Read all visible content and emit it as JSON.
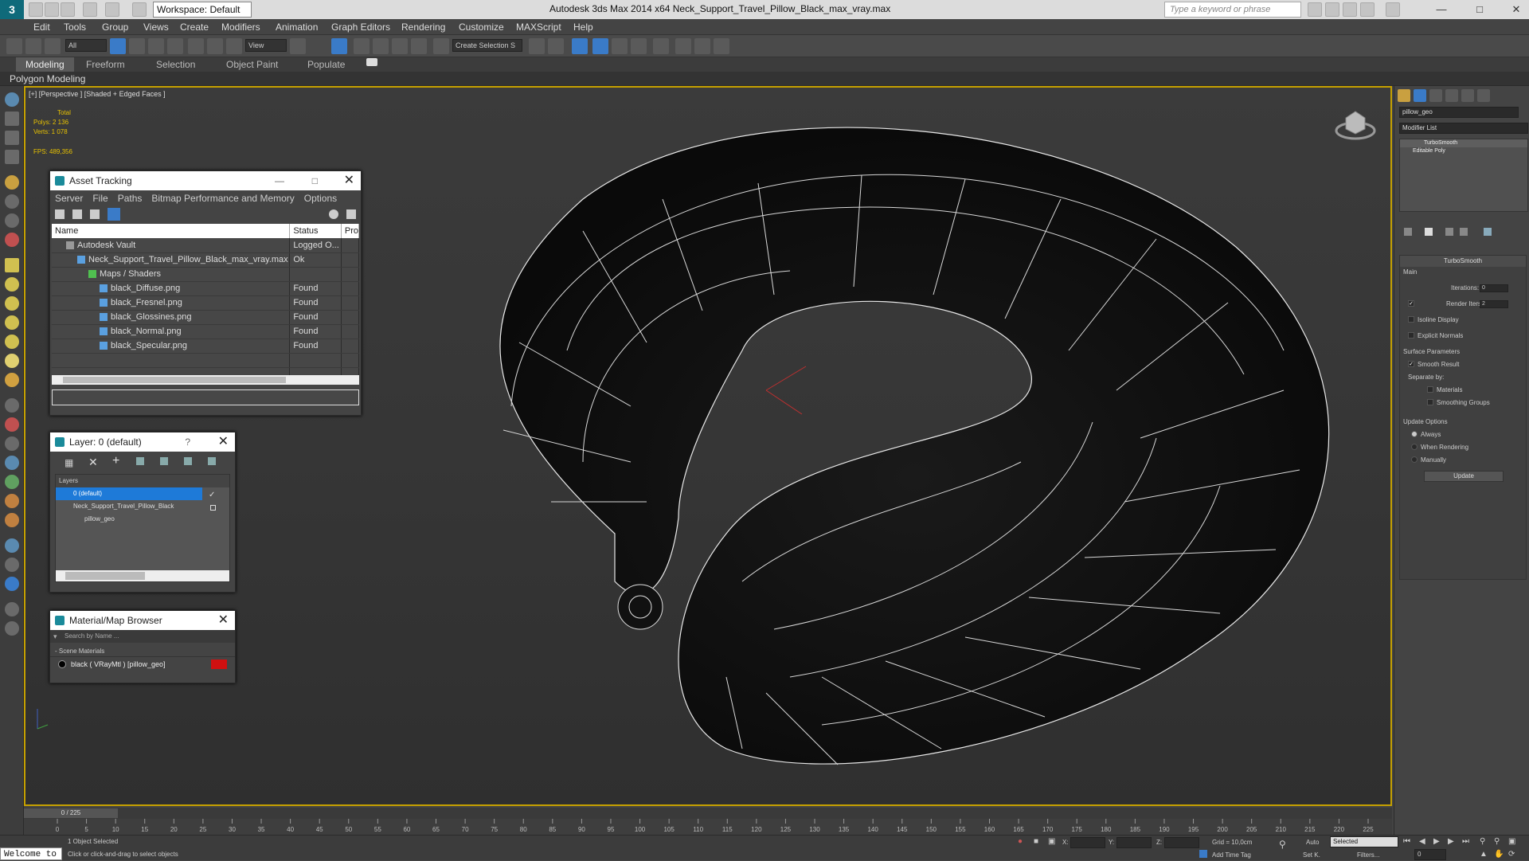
{
  "app": {
    "logo": "3",
    "workspace": "Workspace: Default",
    "title": "Autodesk 3ds Max  2014 x64     Neck_Support_Travel_Pillow_Black_max_vray.max",
    "search_placeholder": "Type a keyword or phrase"
  },
  "menu": [
    "Edit",
    "Tools",
    "Group",
    "Views",
    "Create",
    "Modifiers",
    "Animation",
    "Graph Editors",
    "Rendering",
    "Customize",
    "MAXScript",
    "Help"
  ],
  "toolbar": {
    "filter": "All",
    "refcoord": "View",
    "selection_set": "Create Selection S"
  },
  "ribbon": {
    "tabs": [
      "Modeling",
      "Freeform",
      "Selection",
      "Object Paint",
      "Populate"
    ],
    "active": "Modeling",
    "sub": "Polygon Modeling"
  },
  "viewport": {
    "label": "[+] [Perspective ] [Shaded + Edged Faces ]",
    "stats_total": "Total",
    "polys": "Polys:   2 136",
    "verts": "Verts:   1 078",
    "fps": "FPS:     489,356"
  },
  "asset_tracking": {
    "title": "Asset Tracking",
    "menu": [
      "Server",
      "File",
      "Paths",
      "Bitmap Performance and Memory",
      "Options"
    ],
    "columns": [
      "Name",
      "Status",
      "Pro"
    ],
    "rows": [
      {
        "name": "Autodesk Vault",
        "status": "Logged O...",
        "indent": 1,
        "icon": "vault"
      },
      {
        "name": "Neck_Support_Travel_Pillow_Black_max_vray.max",
        "status": "Ok",
        "indent": 2,
        "icon": "file"
      },
      {
        "name": "Maps / Shaders",
        "status": "",
        "indent": 3,
        "icon": "maps"
      },
      {
        "name": "black_Diffuse.png",
        "status": "Found",
        "indent": 4,
        "icon": "img"
      },
      {
        "name": "black_Fresnel.png",
        "status": "Found",
        "indent": 4,
        "icon": "img"
      },
      {
        "name": "black_Glossines.png",
        "status": "Found",
        "indent": 4,
        "icon": "img"
      },
      {
        "name": "black_Normal.png",
        "status": "Found",
        "indent": 4,
        "icon": "img"
      },
      {
        "name": "black_Specular.png",
        "status": "Found",
        "indent": 4,
        "icon": "img"
      }
    ]
  },
  "layer": {
    "title": "Layer: 0 (default)",
    "help": "?",
    "header": "Layers",
    "items": [
      {
        "name": "0 (default)",
        "selected": true
      },
      {
        "name": "Neck_Support_Travel_Pillow_Black",
        "selected": false
      },
      {
        "name": "pillow_geo",
        "selected": false
      }
    ]
  },
  "material_browser": {
    "title": "Material/Map Browser",
    "search_placeholder": "Search by Name ...",
    "group": "- Scene Materials",
    "item": "black  ( VRayMtl )  [pillow_geo]"
  },
  "command_panel": {
    "object_name": "pillow_geo",
    "modifier_list": "Modifier List",
    "stack": [
      "TurboSmooth",
      "Editable Poly"
    ],
    "rollout_title": "TurboSmooth",
    "main": "Main",
    "iterations_label": "Iterations:",
    "iterations": "0",
    "render_iters_label": "Render Iters:",
    "render_iters": "2",
    "isoline": "Isoline Display",
    "explicit": "Explicit Normals",
    "surface_params": "Surface Parameters",
    "smooth_result": "Smooth Result",
    "separate_by": "Separate by:",
    "materials": "Materials",
    "smoothing_groups": "Smoothing Groups",
    "update_options": "Update Options",
    "always": "Always",
    "when_rendering": "When Rendering",
    "manually": "Manually",
    "update_btn": "Update"
  },
  "timeline": {
    "frame": "0 / 225",
    "ticks": [
      "0",
      "5",
      "10",
      "15",
      "20",
      "25",
      "30",
      "35",
      "40",
      "45",
      "50",
      "55",
      "60",
      "65",
      "70",
      "75",
      "80",
      "85",
      "90",
      "95",
      "100",
      "105",
      "110",
      "115",
      "120",
      "125",
      "130",
      "135",
      "140",
      "145",
      "150",
      "155",
      "160",
      "165",
      "170",
      "175",
      "180",
      "185",
      "190",
      "195",
      "200",
      "205",
      "210",
      "215",
      "220",
      "225"
    ]
  },
  "status": {
    "welcome": "Welcome to",
    "selected": "1 Object Selected",
    "hint": "Click or click-and-drag to select objects",
    "x_label": "X:",
    "y_label": "Y:",
    "z_label": "Z:",
    "grid": "Grid = 10,0cm",
    "auto": "Auto",
    "selected_mode": "Selected",
    "set_key": "Set K.",
    "filters": "Filters...",
    "add_time_tag": "Add Time Tag",
    "frame_field": "0"
  },
  "colors": {
    "accent": "#3a7bc8",
    "viewport_border": "#c5a000",
    "stats": "#e8c200",
    "material_swatch": "#d01010"
  }
}
